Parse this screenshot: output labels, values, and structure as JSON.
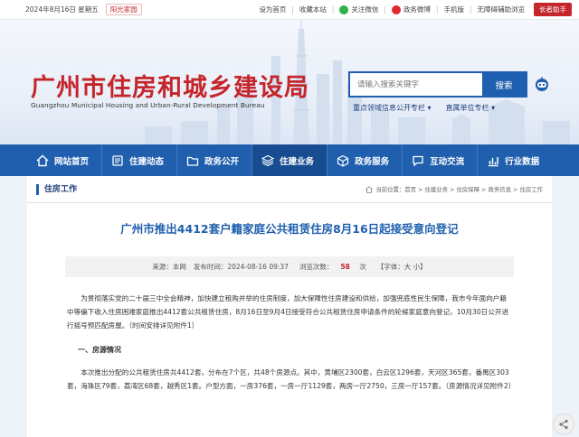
{
  "topbar": {
    "date": "2024年8月16日 星期五",
    "sunshine": "阳光家园",
    "links": [
      "设为首页",
      "收藏本站",
      "关注微信",
      "政务微博",
      "手机版",
      "无障碍辅助浏览"
    ],
    "elder_btn": "长者助手"
  },
  "header": {
    "title": "广州市住房和城乡建设局",
    "subtitle": "Guangzhou Municipal Housing and Urban-Rural Development Bureau",
    "search_placeholder": "请输入搜索关键字",
    "search_button": "搜索",
    "quicklinks": [
      "重点领域信息公开专栏 ▾",
      "直属单位专栏 ▾"
    ]
  },
  "nav": {
    "items": [
      {
        "label": "网站首页",
        "icon": "home-icon"
      },
      {
        "label": "住建动态",
        "icon": "news-icon"
      },
      {
        "label": "政务公开",
        "icon": "folder-icon"
      },
      {
        "label": "住建业务",
        "icon": "layers-icon"
      },
      {
        "label": "政务服务",
        "icon": "cube-icon"
      },
      {
        "label": "互动交流",
        "icon": "chat-icon"
      },
      {
        "label": "行业数据",
        "icon": "chart-icon"
      }
    ]
  },
  "content": {
    "section": "住房工作",
    "breadcrumb": [
      "当前位置：",
      "首页",
      "住建业务",
      "住房保障",
      "政务信息",
      "住房工作"
    ],
    "title": "广州市推出4412套户籍家庭公共租赁住房8月16日起接受意向登记",
    "meta": {
      "source": "来源：本网",
      "publish": "发布时间：2024-08-16 09:37",
      "views_label": "浏览次数：",
      "views": "58",
      "views_unit": "次",
      "font": "【字体：大 小】"
    },
    "paragraphs": [
      "为贯彻落实党的二十届三中全会精神，加快建立租购并举的住房制度，加大保障性住房建设和供给，加强兜底性民生保障，我市今年面向户籍中等偏下收入住房困难家庭推出4412套公共租赁住房，8月16日至9月4日接受符合公共租赁住房申请条件的轮候家庭意向登记，10月30日公开进行摇号预匹配房屋。（时间安排详见附件1）"
    ],
    "heading1": "一、房源情况",
    "paragraph2": "本次推出分配的公共租赁住房共4412套，分布在7个区，共48个房源点。其中，黄埔区2300套，白云区1296套，天河区365套，番禺区303套，海珠区79套，荔湾区68套，越秀区1套。户型方面，一房376套，一房一厅1129套，两房一厅2750，三房一厅157套。（房源情况详见附件2）"
  },
  "colors": {
    "brand_red": "#c4262c",
    "nav_blue": "#1f5fae",
    "title_blue": "#1f5fae"
  }
}
